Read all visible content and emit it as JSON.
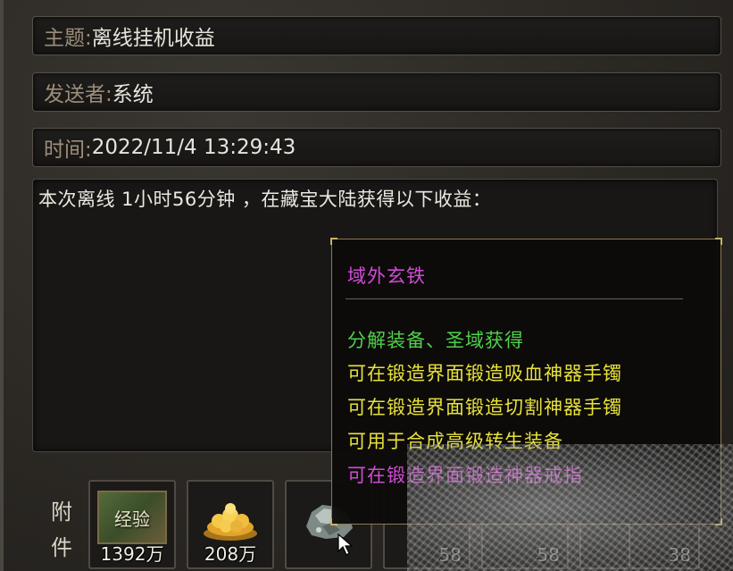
{
  "mail": {
    "subject_label": "主题:",
    "subject_value": "离线挂机收益",
    "sender_label": "发送者:",
    "sender_value": "系统",
    "time_label": "时间:",
    "time_value": "2022/11/4 13:29:43",
    "body": "本次离线 1小时56分钟 ，在藏宝大陆获得以下收益："
  },
  "attachments": {
    "label": "附件",
    "items": [
      {
        "name": "经验",
        "qty": "1392万",
        "icon": "exp-scroll-icon"
      },
      {
        "name": "金币",
        "qty": "208万",
        "icon": "gold-coins-icon"
      },
      {
        "name": "域外玄铁",
        "qty": "",
        "icon": "ore-icon"
      },
      {
        "qty": "58"
      },
      {
        "qty": "58"
      },
      {
        "qty": "58"
      },
      {
        "qty": "38"
      }
    ]
  },
  "tooltip": {
    "title": "域外玄铁",
    "lines": [
      {
        "text": "分解装备、圣域获得",
        "color": "#4fd04a"
      },
      {
        "text": "可在锻造界面锻造吸血神器手镯",
        "color": "#e8e23a"
      },
      {
        "text": "可在锻造界面锻造切割神器手镯",
        "color": "#e8e23a"
      },
      {
        "text": "可用于合成高级转生装备",
        "color": "#e8e23a"
      },
      {
        "text": "可在锻造界面锻造神器戒指",
        "color": "#d14bd6"
      }
    ],
    "title_color": "#d14bd6"
  }
}
